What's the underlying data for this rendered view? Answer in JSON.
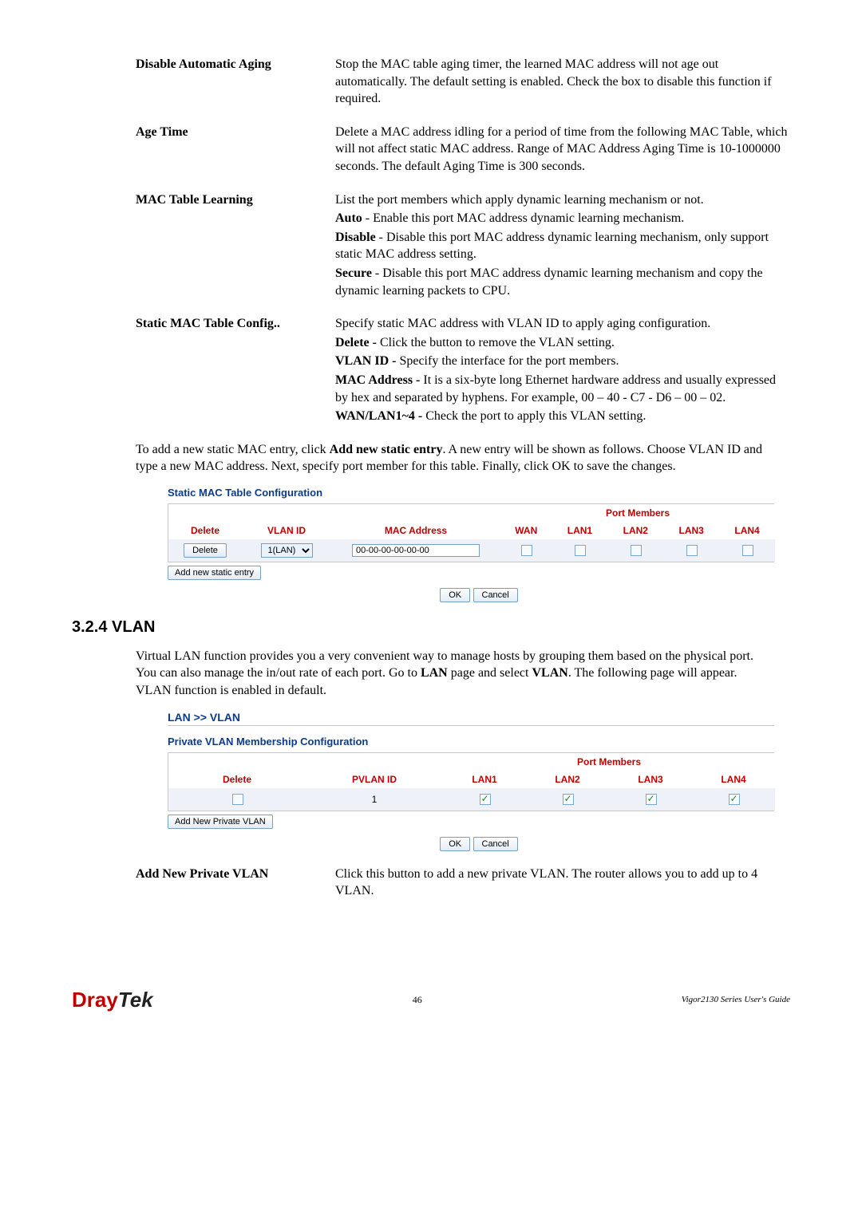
{
  "defs": [
    {
      "term": "Disable Automatic Aging",
      "lines": [
        {
          "text": "Stop the MAC table aging timer, the learned MAC address will not age out automatically. The default setting is enabled. Check the box to disable this function if required."
        }
      ]
    },
    {
      "term": "Age Time",
      "lines": [
        {
          "text": "Delete a MAC address idling for a period of time from the following MAC Table, which will not affect static MAC address. Range of MAC Address Aging Time is 10-1000000 seconds. The default Aging Time is 300 seconds."
        }
      ]
    },
    {
      "term": "MAC Table Learning",
      "lines": [
        {
          "text": "List the port members which apply dynamic learning mechanism or not."
        },
        {
          "bold": "Auto",
          "text": " - Enable this port MAC address dynamic learning mechanism."
        },
        {
          "bold": "Disable",
          "text": " - Disable this port MAC address dynamic learning mechanism, only support static MAC address setting."
        },
        {
          "bold": "Secure",
          "text": " - Disable this port MAC address dynamic learning mechanism and copy the dynamic learning packets to CPU."
        }
      ]
    },
    {
      "term": "Static MAC Table Config..",
      "lines": [
        {
          "text": "Specify static MAC address with VLAN ID to apply aging configuration."
        },
        {
          "bold": "Delete -",
          "text": " Click the button to remove the VLAN setting."
        },
        {
          "bold": "VLAN ID -",
          "text": " Specify the interface for the port members."
        },
        {
          "bold": "MAC Address -",
          "text": " It is a six-byte long Ethernet hardware address and usually expressed by hex and separated by hyphens. For example, 00 – 40 - C7 - D6 – 00 – 02."
        },
        {
          "bold": "WAN/LAN1~4 -",
          "text": " Check the port to apply this VLAN setting."
        }
      ]
    }
  ],
  "para1": "To add a new static MAC entry, click ",
  "para1_bold": "Add new static entry",
  "para1_after": ". A new entry will be shown as follows. Choose VLAN ID and type a new MAC address. Next, specify port member for this table. Finally, click OK to save the changes.",
  "shot1": {
    "title": "Static MAC Table Configuration",
    "port_members": "Port Members",
    "cols": {
      "delete": "Delete",
      "vlanid": "VLAN ID",
      "mac": "MAC Address",
      "wan": "WAN",
      "lan1": "LAN1",
      "lan2": "LAN2",
      "lan3": "LAN3",
      "lan4": "LAN4"
    },
    "row": {
      "delete_btn": "Delete",
      "vlan_sel": "1(LAN)",
      "mac_val": "00-00-00-00-00-00"
    },
    "add_btn": "Add new static entry",
    "ok": "OK",
    "cancel": "Cancel"
  },
  "section": "3.2.4 VLAN",
  "para2_parts": {
    "a": "Virtual LAN function provides you a very convenient way to manage hosts by grouping them based on the physical port. You can also manage the in/out rate of each port. Go to ",
    "b": "LAN",
    "c": " page and select ",
    "d": "VLAN",
    "e": ". The following page will appear. VLAN function is enabled in default."
  },
  "shot2": {
    "crumb": "LAN >> VLAN",
    "sub": "Private VLAN Membership Configuration",
    "port_members": "Port Members",
    "cols": {
      "delete": "Delete",
      "pvlan": "PVLAN ID",
      "lan1": "LAN1",
      "lan2": "LAN2",
      "lan3": "LAN3",
      "lan4": "LAN4"
    },
    "row": {
      "pvlan": "1"
    },
    "add_btn": "Add New Private VLAN",
    "ok": "OK",
    "cancel": "Cancel"
  },
  "def_addvlan": {
    "term": "Add New Private VLAN",
    "body": "Click this button to add a new private VLAN. The router allows you to add up to 4 VLAN."
  },
  "footer": {
    "logo_dray": "Dray",
    "logo_tek": "Tek",
    "page": "46",
    "guide": "Vigor2130  Series  User's  Guide"
  }
}
